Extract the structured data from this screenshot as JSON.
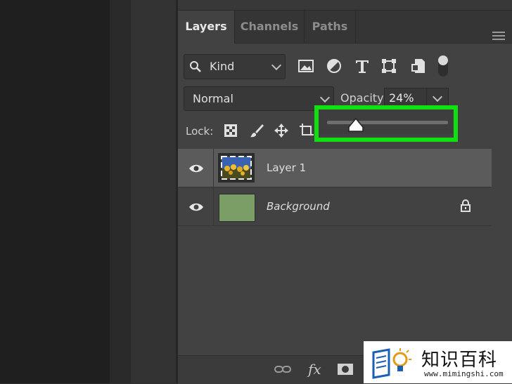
{
  "panel": {
    "tabs": [
      {
        "label": "Layers",
        "active": true
      },
      {
        "label": "Channels",
        "active": false
      },
      {
        "label": "Paths",
        "active": false
      }
    ],
    "filter": {
      "kind_label": "Kind",
      "icons": [
        "image-filter-icon",
        "adjustment-filter-icon",
        "type-filter-icon",
        "shape-filter-icon",
        "smart-object-filter-icon"
      ],
      "toggle_on": true
    },
    "blend_mode": "Normal",
    "opacity_label": "Opacity:",
    "opacity_value": "24%",
    "opacity_slider": {
      "value_percent": 24,
      "highlight_color": "#10e010"
    },
    "lock_label": "Lock:",
    "layers": [
      {
        "name": "Layer 1",
        "selected": true,
        "visible": true,
        "thumbnail": "photo",
        "locked": false
      },
      {
        "name": "Background",
        "selected": false,
        "visible": true,
        "thumbnail": "#7a9e66",
        "locked": true
      }
    ],
    "bottom_bar": {
      "fx_label": "fx"
    }
  },
  "watermark": {
    "title": "知识百科",
    "url": "www.mimingshi.com",
    "accent": "#1a5fb4"
  }
}
